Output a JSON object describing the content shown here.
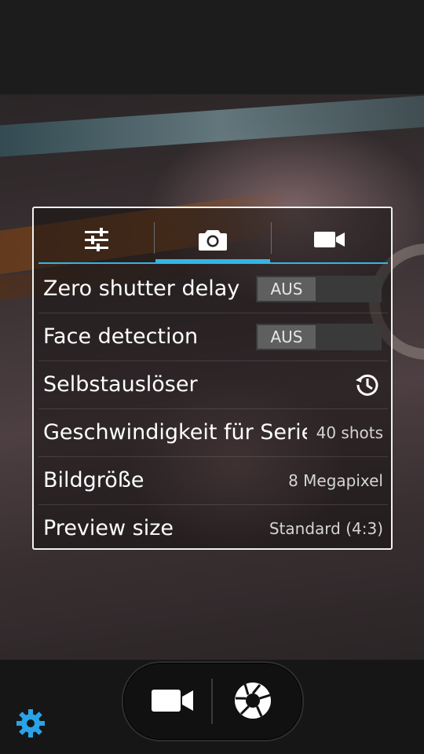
{
  "colors": {
    "accent": "#33b5e5",
    "settings_icon": "#29a3e6"
  },
  "tabs": [
    {
      "icon": "sliders-icon",
      "active": false
    },
    {
      "icon": "camera-icon",
      "active": true
    },
    {
      "icon": "video-camera-icon",
      "active": false
    }
  ],
  "settings": {
    "zero_shutter": {
      "label": "Zero shutter delay",
      "value": "AUS"
    },
    "face_detection": {
      "label": "Face detection",
      "value": "AUS"
    },
    "self_timer": {
      "label": "Selbstauslöser",
      "icon": "timer-icon"
    },
    "burst_speed": {
      "label": "Geschwindigkeit für Serienaufnahmen",
      "value": "40 shots"
    },
    "picture_size": {
      "label": "Bildgröße",
      "value": "8 Megapixel"
    },
    "preview_size": {
      "label": "Preview size",
      "value": "Standard (4:3)"
    }
  },
  "bottom": {
    "video_icon": "video-camera-icon",
    "shutter_icon": "shutter-icon",
    "settings_icon": "gear-icon"
  }
}
